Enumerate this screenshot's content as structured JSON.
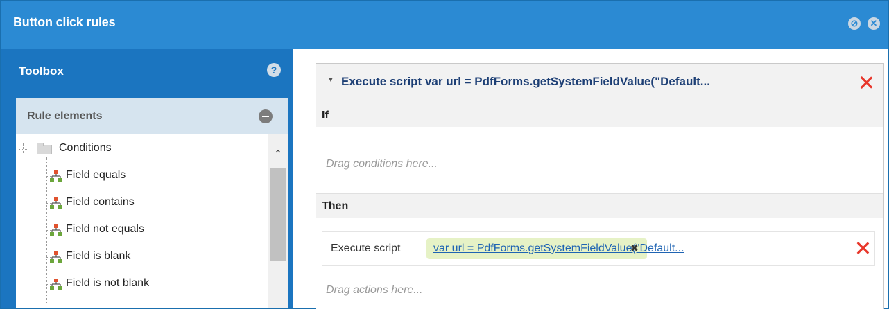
{
  "dialog": {
    "title": "Button click rules",
    "buttons": [
      "restore-icon",
      "close-icon"
    ]
  },
  "toolbox": {
    "header": "Toolbox",
    "help_icon_glyph": "?",
    "panel_title": "Rule elements",
    "tree": {
      "root_label": "Conditions",
      "items": [
        {
          "label": "Field equals",
          "icon": "rule-node-icon"
        },
        {
          "label": "Field contains",
          "icon": "rule-node-icon"
        },
        {
          "label": "Field not equals",
          "icon": "rule-node-icon"
        },
        {
          "label": "Field is blank",
          "icon": "rule-node-icon"
        },
        {
          "label": "Field is not blank",
          "icon": "rule-node-icon"
        }
      ]
    },
    "scroll_up_glyph": "^"
  },
  "editor": {
    "rule_title": "Execute script var url = PdfForms.getSystemFieldValue(\"Default...",
    "if_label": "If",
    "conditions_placeholder": "Drag conditions here...",
    "then_label": "Then",
    "action": {
      "label": "Execute script",
      "script_link": "var url = PdfForms.getSystemFieldValue(\"Default..."
    },
    "actions_placeholder": "Drag actions here..."
  },
  "colors": {
    "title_bar": "#2b8ad3",
    "toolbox_bg": "#1b75c0",
    "accent_delete": "#e8372b",
    "link": "#1f64b3",
    "chip_bg": "#e6f2c6"
  }
}
